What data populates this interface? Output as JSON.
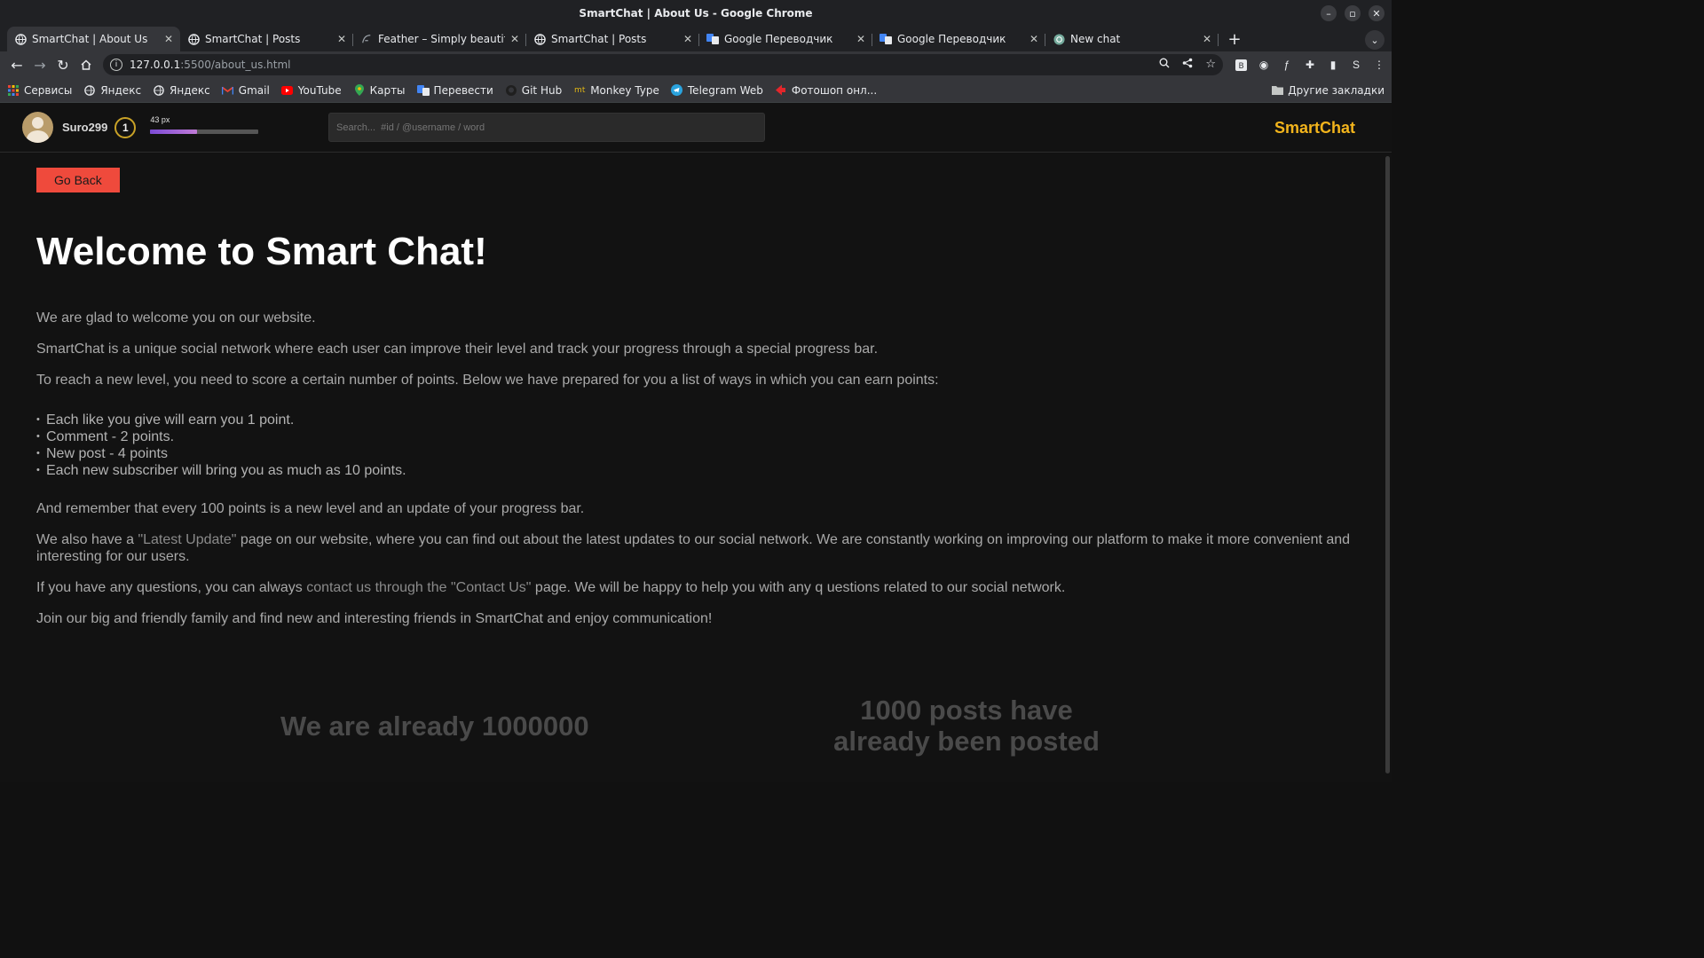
{
  "window": {
    "title": "SmartChat | About Us - Google Chrome",
    "controls": [
      "–",
      "▫",
      "✕"
    ]
  },
  "tabs": [
    {
      "label": "SmartChat | About Us",
      "icon": "globe-icon",
      "active": true
    },
    {
      "label": "SmartChat | Posts",
      "icon": "globe-icon",
      "active": false
    },
    {
      "label": "Feather – Simply beautifu",
      "icon": "feather-icon",
      "active": false
    },
    {
      "label": "SmartChat | Posts",
      "icon": "globe-icon",
      "active": false
    },
    {
      "label": "Google Переводчик",
      "icon": "translate-icon",
      "active": false
    },
    {
      "label": "Google Переводчик",
      "icon": "translate-icon",
      "active": false
    },
    {
      "label": "New chat",
      "icon": "chatgpt-icon",
      "active": false
    }
  ],
  "toolbar": {
    "url_host": "127.0.0.1",
    "url_path": ":5500/about_us.html"
  },
  "bookmarks": {
    "items": [
      {
        "label": "Сервисы",
        "icon": "apps-grid-icon"
      },
      {
        "label": "Яндекс",
        "icon": "globe-icon"
      },
      {
        "label": "Яндекс",
        "icon": "globe-icon"
      },
      {
        "label": "Gmail",
        "icon": "gmail-icon"
      },
      {
        "label": "YouTube",
        "icon": "youtube-icon"
      },
      {
        "label": "Карты",
        "icon": "maps-icon"
      },
      {
        "label": "Перевести",
        "icon": "translate-icon"
      },
      {
        "label": "Git Hub",
        "icon": "github-icon"
      },
      {
        "label": "Monkey Type",
        "icon": "monkeytype-icon"
      },
      {
        "label": "Telegram Web",
        "icon": "telegram-icon"
      },
      {
        "label": "Фотошоп онл...",
        "icon": "photoshop-icon"
      }
    ],
    "other": "Другие закладки"
  },
  "site": {
    "username": "Suro299",
    "level": "1",
    "progress_label": "43 px",
    "progress_fraction": 0.43,
    "search_placeholder": "Search...  #id / @username / word",
    "brand": "SmartChat",
    "brand_color": "#f2b41c",
    "accent_button_color": "#ef4a3c"
  },
  "content": {
    "go_back": "Go Back",
    "heading": "Welcome to Smart Chat!",
    "p1": "We are glad to welcome you on our website.",
    "p2": "SmartChat is a unique social network where each user can improve their level and track your progress through a special progress bar.",
    "p3": "To reach a new level, you need to score a certain number of points. Below we have prepared for you a list of ways in which you can earn points:",
    "ways": [
      "Each like you give will earn you 1 point.",
      "Comment - 2 points.",
      "New post - 4 points",
      "Each new subscriber will bring you as much as 10 points."
    ],
    "p4": "And remember that every 100 points is a new level and an update of your progress bar.",
    "p5_before": "We also have a ",
    "p5_link": "\"Latest Update\"",
    "p5_after": " page on our website, where you can find out about the latest updates to our social network. We are constantly working on improving our platform to make it more convenient and interesting for our users.",
    "p6_before": "If you have any questions, you can always ",
    "p6_link": "contact us through the \"Contact Us\"",
    "p6_after": " page. We will be happy to help you with any q uestions related to our social network.",
    "p7": "Join our big and friendly family and find new and interesting friends in SmartChat and enjoy communication!",
    "stat1": "We are already 1000000",
    "stat2_line1": "1000 posts have",
    "stat2_line2": "already been posted"
  }
}
